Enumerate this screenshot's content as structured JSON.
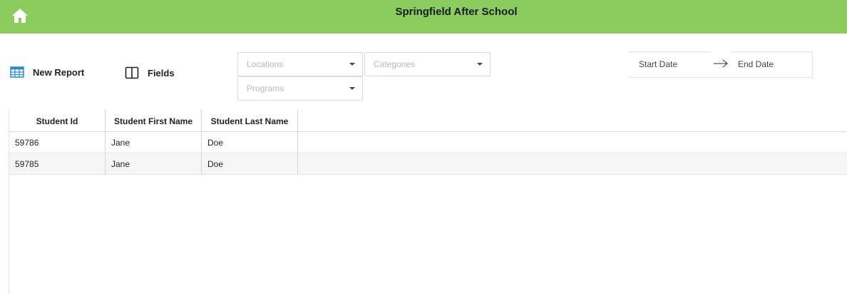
{
  "header": {
    "title": "Springfield After School",
    "background": "#8bcc5f",
    "home_icon": "home-icon"
  },
  "toolbar": {
    "new_report_label": "New Report",
    "new_report_icon": "table-icon",
    "fields_label": "Fields",
    "fields_icon": "columns-icon"
  },
  "filters": {
    "locations_placeholder": "Locations",
    "categories_placeholder": "Categories",
    "programs_placeholder": "Programs"
  },
  "date_range": {
    "start_placeholder": "Start Date",
    "end_placeholder": "End Date"
  },
  "table": {
    "columns": [
      "Student Id",
      "Student First Name",
      "Student Last Name"
    ],
    "rows": [
      [
        "59786",
        "Jane",
        "Doe"
      ],
      [
        "59785",
        "Jane",
        "Doe"
      ]
    ]
  },
  "colors": {
    "accent_icon": "#2a8ccf",
    "alt_row": "#f5f6f8"
  }
}
